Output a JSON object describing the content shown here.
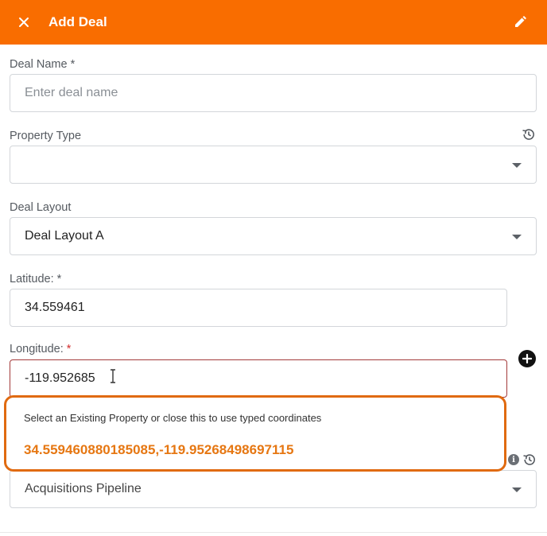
{
  "header": {
    "title": "Add Deal",
    "background": "#f96d00"
  },
  "deal_name": {
    "label": "Deal Name",
    "required_mark": "*",
    "placeholder": "Enter deal name",
    "value": ""
  },
  "property_type": {
    "label": "Property Type",
    "value": ""
  },
  "deal_layout": {
    "label": "Deal Layout",
    "value": "Deal Layout A"
  },
  "latitude": {
    "label": "Latitude:",
    "required_mark": "*",
    "value": "34.559461"
  },
  "longitude": {
    "label": "Longitude:",
    "required_mark": "*",
    "value": "-119.952685"
  },
  "coordinate_popup": {
    "message": "Select an Existing Property or close this to use typed coordinates",
    "option": "34.559460880185085,-119.95268498697115",
    "accent": "#e67712"
  },
  "pipeline": {
    "value": "Acquisitions Pipeline"
  },
  "icons": {
    "close": "close-icon",
    "edit": "pencil-icon",
    "history": "history-icon",
    "add": "plus-circle-icon",
    "info": "info-icon",
    "dropdown": "caret-down-icon"
  }
}
